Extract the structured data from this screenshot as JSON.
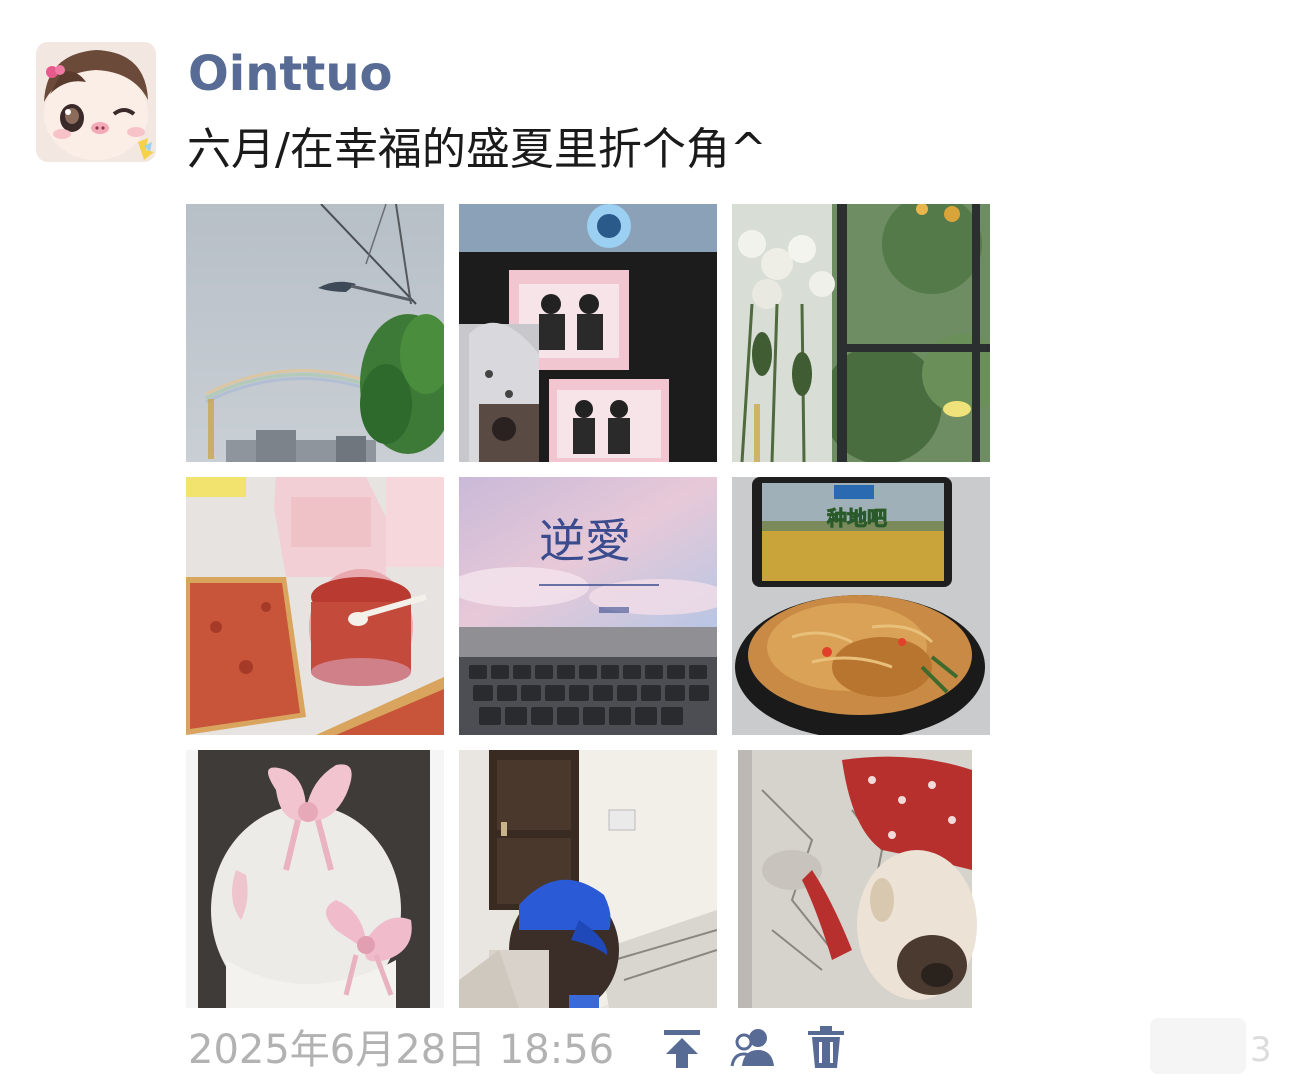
{
  "post": {
    "username": "Ointtuo",
    "text": "六月/在幸福的盛夏里折个角^",
    "timestamp": "2025年6月28日 18:56"
  },
  "photos": [
    {
      "name": "photo-rainbow-sky"
    },
    {
      "name": "photo-monitor-stickers"
    },
    {
      "name": "photo-window-flowers"
    },
    {
      "name": "photo-jam-toast"
    },
    {
      "name": "photo-laptop-screen"
    },
    {
      "name": "photo-noodle-bowl"
    },
    {
      "name": "photo-white-dress-bows"
    },
    {
      "name": "photo-blue-cap-selfie"
    },
    {
      "name": "photo-dog-red-cloth"
    }
  ],
  "laptop_screen_title": "逆愛",
  "tablet_show_title": "种地吧",
  "colors": {
    "username": "#576b95",
    "icon_blue": "#576b95",
    "timestamp": "#b2b2b2"
  },
  "icons": {
    "pin": "pin-to-top-icon",
    "privacy": "visibility-contacts-icon",
    "delete": "trash-icon"
  }
}
